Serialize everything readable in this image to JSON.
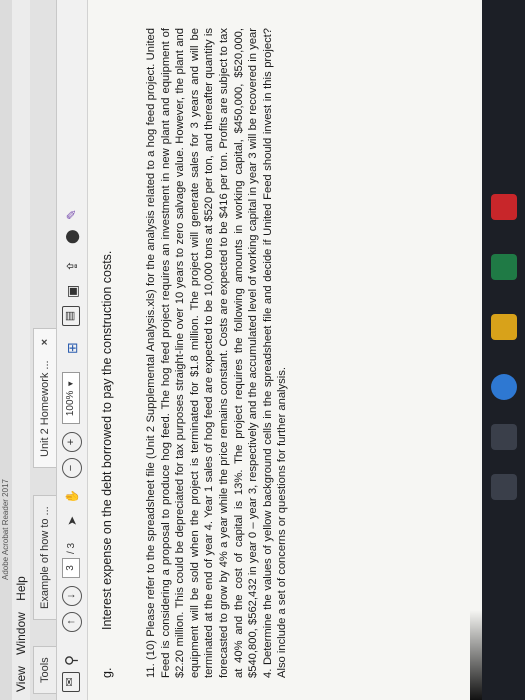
{
  "window": {
    "title": "Adobe Acrobat Reader 2017",
    "menus": [
      "View",
      "Window",
      "Help"
    ]
  },
  "tabs": {
    "tools": "Tools",
    "tab1": "Example of how to ...",
    "tab2": "Unit 2 Homework ...",
    "close": "×"
  },
  "toolbar": {
    "page_current": "3",
    "page_total": "/ 3",
    "zoom": "100%",
    "icons": [
      "mail-icon",
      "search-icon",
      "page-up-icon",
      "page-down-icon",
      "cursor-icon",
      "hand-icon",
      "zoom-out-icon",
      "zoom-in-icon",
      "zoom-dropdown-icon",
      "fit-page-icon",
      "comment-icon",
      "sign-icon",
      "share-icon",
      "highlight-icon",
      "pen-icon"
    ]
  },
  "document": {
    "item_g_label": "g.",
    "item_g_text": "Interest expense on the debt borrowed to pay the construction costs.",
    "q11": "11. (10) Please refer to the spreadsheet file (Unit 2 Supplemental Analysis.xls) for the analysis related to a hog feed project. United Feed is considering a proposal to produce hog feed. The hog feed project requires an investment in new plant and equipment of $2.20 million. This could be depreciated for tax purposes straight-line over 10 years to zero salvage value. However, the plant and equipment will be sold when the project is terminated for $1.8 million. The project will generate sales for 3 years and will be terminated at the end of year 4. Year 1 sales of hog feed are expected to be 10,000 tons at $520 per ton, and thereafter quantity is forecasted to grow by 4% a year while the price remains constant. Costs are expected to be $416 per ton. Profits are subject to tax at 40% and the cost of capital is 13%. The project requires the following amounts in working capital, $450,000, $520,000, $540,800, $562,432 in year 0 – year 3, respectively and the accumulated level of working capital in year 3 will be recovered in year 4. Determine the values of yellow background cells in the spreadsheet file and decide if United Feed should invest in this project? Also include a set of concerns or questions for further analysis."
  },
  "colors": {
    "page_bg": "#f6f6f3",
    "taskbar_bg": "#1c1f26",
    "ie_blue": "#2e78d2",
    "excel_green": "#1f7a45",
    "acrobat_red": "#c8262a"
  }
}
